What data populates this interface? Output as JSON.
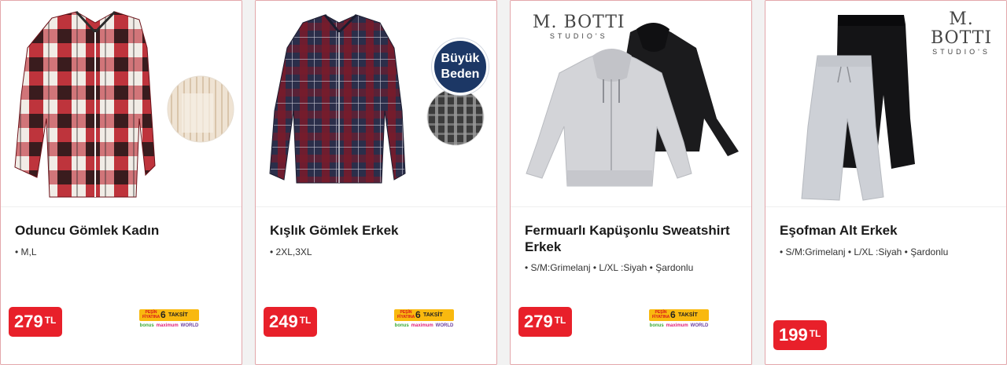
{
  "products": [
    {
      "title": "Oduncu Gömlek Kadın",
      "features": "• M,L",
      "price": "279",
      "currency": "TL",
      "installment": {
        "pesin": "PEŞİN FİYATINA",
        "count": "6",
        "label": "TAKSİT",
        "cards": [
          "bonus",
          "maximum",
          "WORLD"
        ]
      }
    },
    {
      "title": "Kışlık Gömlek Erkek",
      "features": "• 2XL,3XL",
      "price": "249",
      "currency": "TL",
      "badge": [
        "Büyük",
        "Beden"
      ],
      "installment": {
        "pesin": "PEŞİN FİYATINA",
        "count": "6",
        "label": "TAKSİT",
        "cards": [
          "bonus",
          "maximum",
          "WORLD"
        ]
      }
    },
    {
      "title_line1": "Fermuarlı Kapüşonlu Sweatshirt",
      "title_line2": "Erkek",
      "features": "• S/M:Grimelanj • L/XL :Siyah • Şardonlu",
      "price": "279",
      "currency": "TL",
      "brand": {
        "name": "M. BOTTI",
        "sub": "STUDIO'S"
      },
      "installment": {
        "pesin": "PEŞİN FİYATINA",
        "count": "6",
        "label": "TAKSİT",
        "cards": [
          "bonus",
          "maximum",
          "WORLD"
        ]
      }
    },
    {
      "title": "Eşofman Alt Erkek",
      "features": "• S/M:Grimelanj • L/XL :Siyah • Şardonlu",
      "price": "199",
      "currency": "TL",
      "brand": {
        "name": "M. BOTTI",
        "sub": "STUDIO'S"
      }
    }
  ],
  "colors": {
    "price_red": "#e8202a",
    "border": "#e3a7ab",
    "taksit_yellow": "#f9b90f",
    "badge_navy": "#1c3765"
  }
}
